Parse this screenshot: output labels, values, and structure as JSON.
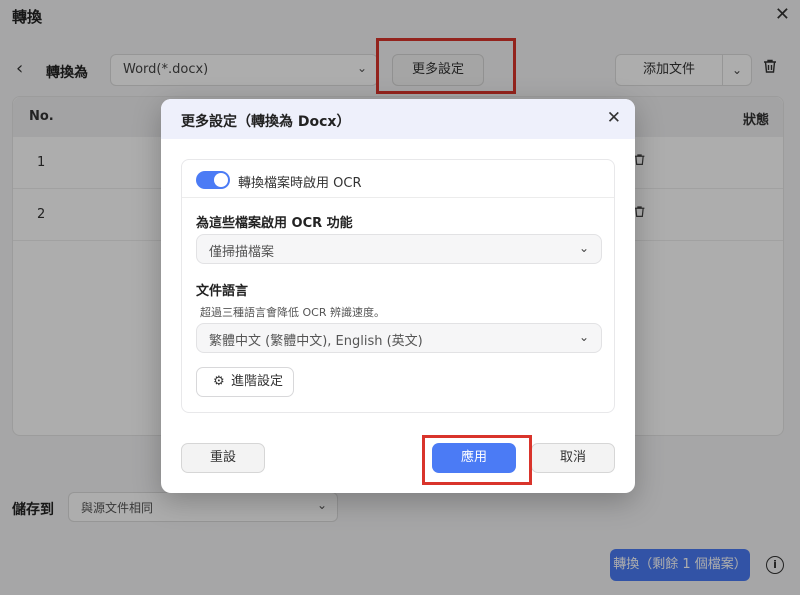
{
  "window": {
    "title": "轉換",
    "close_icon": "close-icon"
  },
  "toolbar": {
    "back_icon": "chevron-left-icon",
    "convert_to_label": "轉換為",
    "format_value": "Word(*.docx)",
    "more_settings_label": "更多設定",
    "add_file_label": "添加文件"
  },
  "table": {
    "columns": {
      "no": "No.",
      "status": "狀態"
    },
    "rows": [
      {
        "no": "1"
      },
      {
        "no": "2"
      }
    ]
  },
  "footer": {
    "save_to_label": "儲存到",
    "save_to_value": "與源文件相同",
    "convert_button": "轉換（剩餘 1 個檔案）"
  },
  "modal": {
    "title": "更多設定（轉換為 Docx）",
    "ocr_toggle_label": "轉換檔案時啟用 OCR",
    "ocr_toggle_on": true,
    "enable_for_label": "為這些檔案啟用 OCR 功能",
    "enable_for_value": "僅掃描檔案",
    "language_label": "文件語言",
    "language_hint": "超過三種語言會降低 OCR 辨識速度。",
    "language_value": "繁體中文 (繁體中文), English (英文)",
    "advanced_button": "進階設定",
    "reset_button": "重設",
    "apply_button": "應用",
    "cancel_button": "取消"
  },
  "colors": {
    "accent": "#4b7bf5",
    "highlight": "#d9342b"
  }
}
